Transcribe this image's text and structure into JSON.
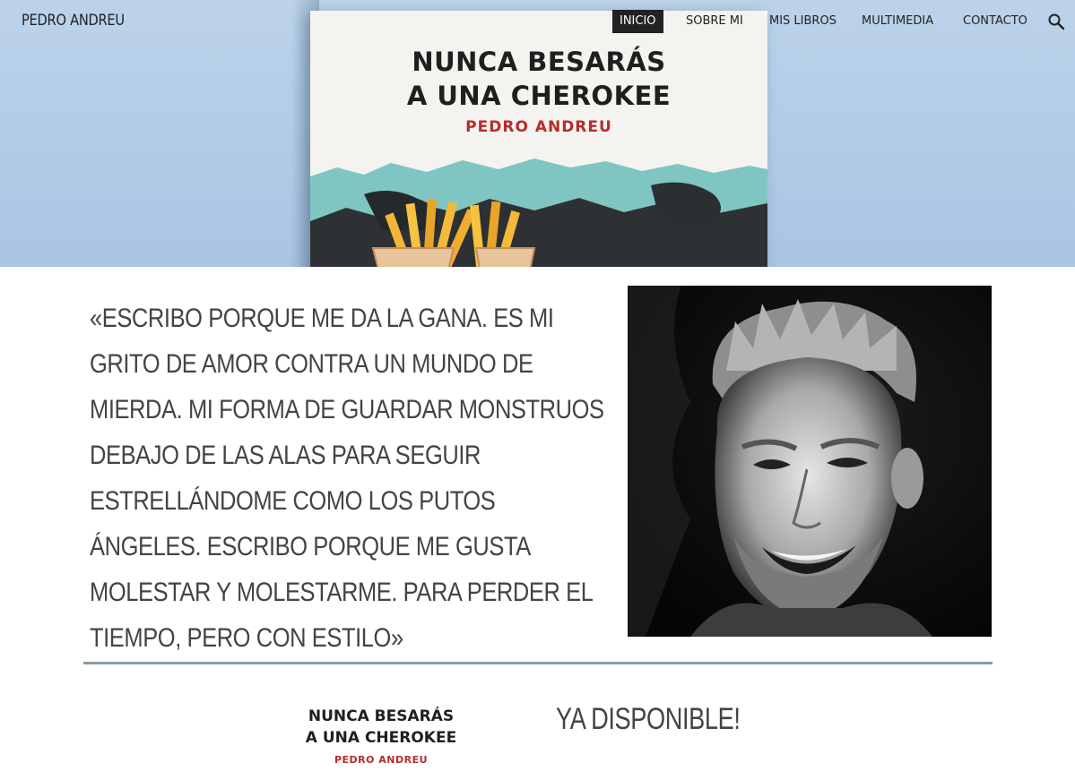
{
  "site": {
    "title": "PEDRO ANDREU"
  },
  "nav": {
    "items": [
      {
        "label": "INICIO",
        "active": true
      },
      {
        "label": "SOBRE MI"
      },
      {
        "label": "MIS LIBROS"
      },
      {
        "label": "MULTIMEDIA"
      },
      {
        "label": "CONTACTO"
      }
    ],
    "search_icon": "search-icon"
  },
  "hero": {
    "book_title_line1": "NUNCA BESARÁS",
    "book_title_line2": "A UNA CHEROKEE",
    "book_author": "PEDRO ANDREU"
  },
  "quote": {
    "text": "«ESCRIBO PORQUE ME DA LA GANA. ES MI GRITO DE AMOR CONTRA UN MUNDO DE MIERDA. MI FORMA DE GUARDAR MONSTRUOS DEBAJO DE LAS ALAS PARA SEGUIR ESTRELLÁNDOME COMO LOS PUTOS ÁNGELES. ESCRIBO PORQUE ME GUSTA MOLESTAR Y MOLESTARME. PARA PERDER EL TIEMPO, PERO CON ESTILO»"
  },
  "promo": {
    "book_title_line1": "NUNCA BESARÁS",
    "book_title_line2": "A UNA CHEROKEE",
    "book_author": "PEDRO ANDREU",
    "availability": "YA DISPONIBLE!"
  },
  "colors": {
    "hero_bg": "#b3cce7",
    "nav_active_bg": "#222222",
    "author_red": "#b62d2d",
    "divider": "#8a9aa4"
  }
}
